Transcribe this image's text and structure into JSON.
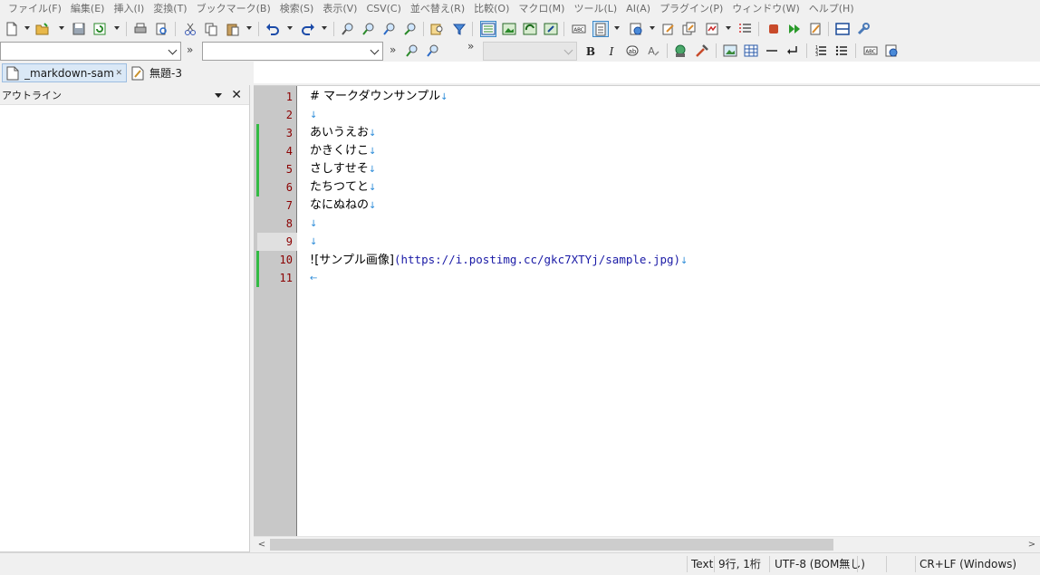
{
  "menu": [
    "ファイル(F)",
    "編集(E)",
    "挿入(I)",
    "変換(T)",
    "ブックマーク(B)",
    "検索(S)",
    "表示(V)",
    "CSV(C)",
    "並べ替え(R)",
    "比較(O)",
    "マクロ(M)",
    "ツール(L)",
    "AI(A)",
    "プラグイン(P)",
    "ウィンドウ(W)",
    "ヘルプ(H)"
  ],
  "tabs": [
    {
      "label": "_markdown-sample.",
      "icon": "document-icon",
      "active": true
    },
    {
      "label": "無題-3",
      "icon": "edit-document-icon",
      "active": false
    }
  ],
  "outline": {
    "title": "アウトライン"
  },
  "editor": {
    "line_numbers": [
      "1",
      "2",
      "3",
      "4",
      "5",
      "6",
      "7",
      "8",
      "9",
      "10",
      "11"
    ],
    "current_line": 9,
    "lines": [
      {
        "text": "# マークダウンサンプル",
        "eol": "↓"
      },
      {
        "text": "",
        "eol": "↓"
      },
      {
        "text": "あいうえお",
        "eol": "↓"
      },
      {
        "text": "かきくけこ",
        "eol": "↓"
      },
      {
        "text": "さしすせそ",
        "eol": "↓"
      },
      {
        "text": "たちつてと",
        "eol": "↓"
      },
      {
        "text": "なにぬねの",
        "eol": "↓"
      },
      {
        "text": "",
        "eol": "↓"
      },
      {
        "text": "",
        "eol": "↓"
      },
      {
        "text": "![サンプル画像]",
        "link": "(https://i.postimg.cc/gkc7XTYj/sample.jpg)",
        "eol": "↓"
      },
      {
        "text": "",
        "eol": "←"
      }
    ]
  },
  "status": {
    "mode": "Text",
    "position": "9行, 1桁",
    "encoding": "UTF-8 (BOM無し)",
    "newline": "CR+LF (Windows)"
  },
  "colors": {
    "modified_marker": "#33bb44",
    "line_number": "#8b0000",
    "eol_mark": "#2a8ad8",
    "url": "#1a1aa6"
  }
}
